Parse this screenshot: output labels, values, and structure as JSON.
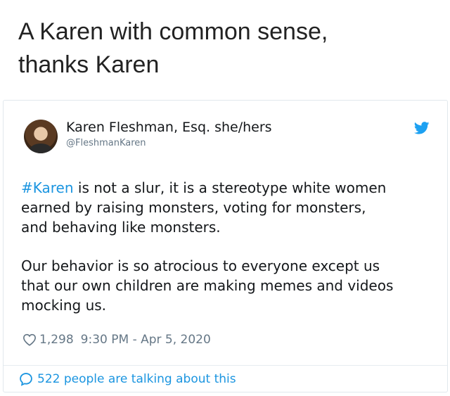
{
  "headline": {
    "line1": "A Karen with common sense,",
    "line2": "thanks Karen"
  },
  "tweet": {
    "author_name": "Karen Fleshman, Esq. she/hers",
    "author_handle": "@FleshmanKaren",
    "paragraph1": {
      "hashtag": "#Karen",
      "line1_rest": " is not a slur, it is a stereotype white women",
      "line2": "earned by raising monsters, voting for monsters,",
      "line3": "and behaving like monsters."
    },
    "paragraph2": {
      "line1": "Our behavior is so atrocious to everyone except us",
      "line2": "that our own children are making memes and videos",
      "line3": "mocking us."
    },
    "likes": "1,298",
    "timestamp": "9:30 PM - Apr 5, 2020",
    "talking": "522 people are talking about this"
  },
  "icons": {
    "bird": "twitter-bird-icon",
    "heart": "heart-icon",
    "bubble": "speech-bubble-icon"
  },
  "colors": {
    "link_blue": "#1b95e0",
    "meta_gray": "#657786",
    "border": "#e1e8ed"
  }
}
